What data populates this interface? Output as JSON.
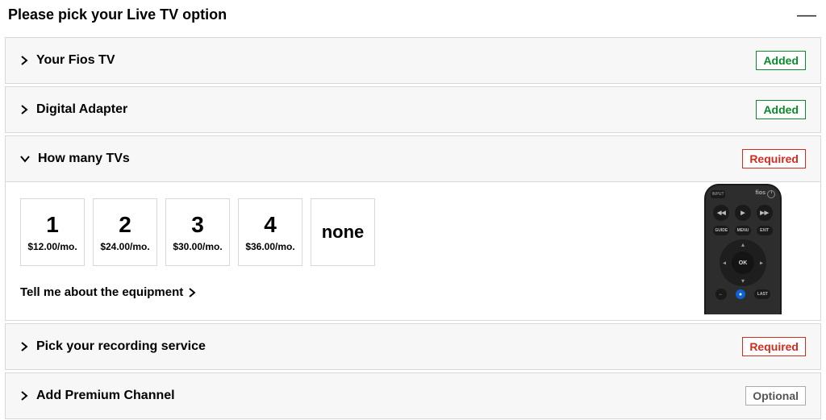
{
  "header": {
    "title": "Please pick your Live TV option"
  },
  "badges": {
    "added": "Added",
    "required": "Required",
    "optional": "Optional"
  },
  "panels": {
    "fios_tv": {
      "title": "Your Fios TV"
    },
    "digital_adapter": {
      "title": "Digital Adapter"
    },
    "how_many_tvs": {
      "title": "How many TVs"
    },
    "recording": {
      "title": "Pick your recording service"
    },
    "premium": {
      "title": "Add Premium Channel"
    }
  },
  "tv_options": [
    {
      "label": "1",
      "price": "$12.00/mo."
    },
    {
      "label": "2",
      "price": "$24.00/mo."
    },
    {
      "label": "3",
      "price": "$30.00/mo."
    },
    {
      "label": "4",
      "price": "$36.00/mo."
    },
    {
      "label": "none",
      "price": ""
    }
  ],
  "equipment_link": "Tell me about the equipment",
  "remote": {
    "brand": "fios",
    "input": "INPUT",
    "ok": "OK",
    "guide": "GUIDE",
    "menu": "MENU",
    "exit": "EXIT",
    "last": "LAST"
  }
}
